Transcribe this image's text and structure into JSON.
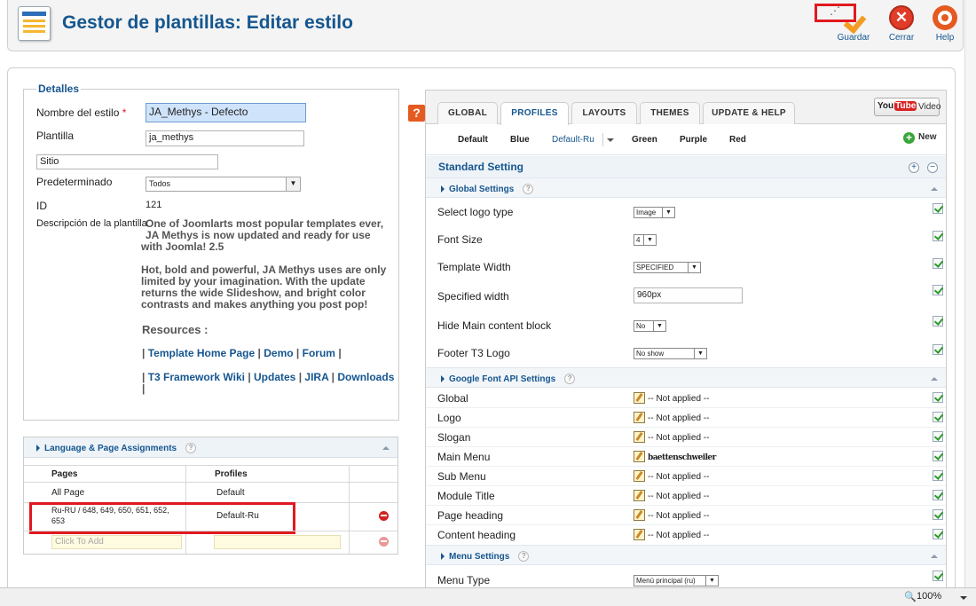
{
  "header": {
    "title": "Gestor de plantillas: Editar estilo",
    "save_label": "Guardar",
    "close_label": "Cerrar",
    "help_label": "Help"
  },
  "details": {
    "legend": "Detalles",
    "name_label": "Nombre del estilo",
    "name_required": "*",
    "name_value": "JA_Methys - Defecto",
    "template_label": "Plantilla",
    "template_value": "ja_methys",
    "site_label": "Sitio",
    "default_label": "Predeterminado",
    "default_value": "Todos",
    "id_label": "ID",
    "id_value": "121",
    "desc_label": "Descripción de la plantilla",
    "desc_p1_l1": "One of Joomlarts most popular templates ever,",
    "desc_p1_l2": "JA Methys is now updated and ready for use",
    "desc_p1_l3": "with Joomla! 2.5",
    "desc_p2_l1": "Hot, bold and powerful, JA Methys uses are only",
    "desc_p2_l2": "limited by your imagination. With the update",
    "desc_p2_l3": "returns the wide Slideshow, and bright color",
    "desc_p2_l4": "contrasts and makes anything you post pop!",
    "resources": "Resources :",
    "sep": "|",
    "link_home": "Template Home Page",
    "link_demo": "Demo",
    "link_forum": "Forum",
    "link_wiki": "T3 Framework Wiki",
    "link_updates": "Updates",
    "link_jira": "JIRA",
    "link_downloads": "Downloads"
  },
  "language": {
    "title": "Language & Page Assignments",
    "help": "?",
    "col_pages": "Pages",
    "col_profiles": "Profiles",
    "rows": [
      {
        "page": "All Page",
        "profile": "Default"
      },
      {
        "page_l1": "Ru-RU / 648, 649, 650, 651, 652,",
        "page_l2": "653",
        "profile": "Default-Ru"
      }
    ],
    "add_placeholder": "Click To Add"
  },
  "help_q": "?",
  "tabs": [
    "GLOBAL",
    "PROFILES",
    "LAYOUTS",
    "THEMES",
    "UPDATE & HELP"
  ],
  "video": {
    "yt_you": "You",
    "yt_tube": "Tube",
    "label": "Video"
  },
  "profiles": {
    "items": [
      "Default",
      "Blue",
      "Default-Ru",
      "Green",
      "Purple",
      "Red"
    ],
    "new_label": "New"
  },
  "standard_setting": "Standard Setting",
  "global_settings": {
    "title": "Global Settings",
    "help": "?",
    "rows": [
      {
        "label": "Select logo type",
        "value": "Image"
      },
      {
        "label": "Font Size",
        "value": "4"
      },
      {
        "label": "Template Width",
        "value": "SPECIFIED"
      },
      {
        "label": "Specified width",
        "value": "960px"
      },
      {
        "label": "Hide Main content block",
        "value": "No"
      },
      {
        "label": "Footer T3 Logo",
        "value": "No show"
      }
    ]
  },
  "google_fonts": {
    "title": "Google Font API Settings",
    "help": "?",
    "rows": [
      {
        "label": "Global",
        "value": "-- Not applied --"
      },
      {
        "label": "Logo",
        "value": "-- Not applied --"
      },
      {
        "label": "Slogan",
        "value": "-- Not applied --"
      },
      {
        "label": "Main Menu",
        "value": "baettenschweiler"
      },
      {
        "label": "Sub Menu",
        "value": "-- Not applied --"
      },
      {
        "label": "Module Title",
        "value": "-- Not applied --"
      },
      {
        "label": "Page heading",
        "value": "-- Not applied --"
      },
      {
        "label": "Content heading",
        "value": "-- Not applied --"
      }
    ]
  },
  "menu_settings": {
    "title": "Menu Settings",
    "help": "?",
    "rows": [
      {
        "label": "Menu Type",
        "value": "Menú principal (ru)"
      }
    ]
  },
  "status": {
    "zoom": "100%"
  }
}
